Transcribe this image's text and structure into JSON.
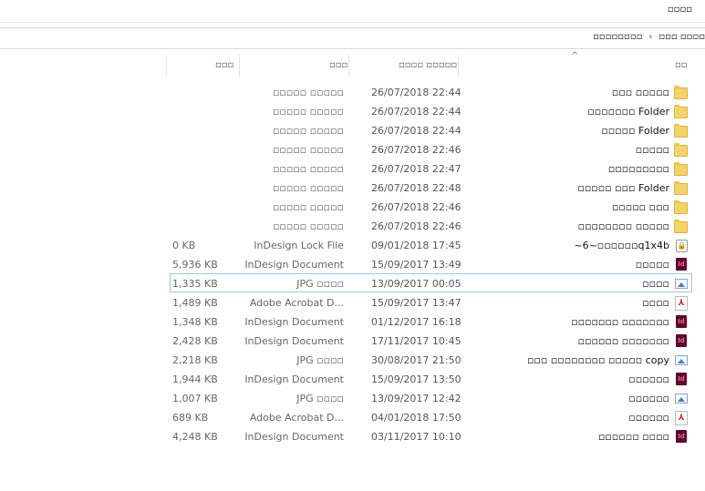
{
  "toolbar": {
    "view_tab": "▫▫▫▫"
  },
  "address": {
    "parent": "▫▫▫ ▫▫▫▫",
    "separator": "‹",
    "current": "▫▫▫▫▫▫▫▫"
  },
  "columns": {
    "name": "▫▫",
    "date": "▫▫▫▫ ▫▫▫▫▫",
    "type": "▫▫▫",
    "size": "▫▫▫"
  },
  "files": [
    {
      "name": "▫▫▫ ▫▫▫▫▫",
      "date": "26/07/2018 22:44",
      "type": "▫▫▫▫▫ ▫▫▫▫▫",
      "size": "",
      "icon": "folder-icon"
    },
    {
      "name": "▫▫▫▫▫▫▫ Folder",
      "date": "26/07/2018 22:44",
      "type": "▫▫▫▫▫ ▫▫▫▫▫",
      "size": "",
      "icon": "folder-icon"
    },
    {
      "name": "▫▫▫▫▫ Folder",
      "date": "26/07/2018 22:44",
      "type": "▫▫▫▫▫ ▫▫▫▫▫",
      "size": "",
      "icon": "folder-icon"
    },
    {
      "name": "▫▫▫▫▫",
      "date": "26/07/2018 22:46",
      "type": "▫▫▫▫▫ ▫▫▫▫▫",
      "size": "",
      "icon": "folder-icon"
    },
    {
      "name": "▫▫▫▫▫▫▫▫▫",
      "date": "26/07/2018 22:47",
      "type": "▫▫▫▫▫ ▫▫▫▫▫",
      "size": "",
      "icon": "folder-icon"
    },
    {
      "name": "▫▫▫▫▫ ▫▫▫ Folder",
      "date": "26/07/2018 22:48",
      "type": "▫▫▫▫▫ ▫▫▫▫▫",
      "size": "",
      "icon": "folder-icon"
    },
    {
      "name": "▫▫▫▫▫ ▫▫▫",
      "date": "26/07/2018 22:46",
      "type": "▫▫▫▫▫ ▫▫▫▫▫",
      "size": "",
      "icon": "folder-icon"
    },
    {
      "name": "▫▫▫▫▫▫▫▫ ▫▫▫▫▫",
      "date": "26/07/2018 22:46",
      "type": "▫▫▫▫▫ ▫▫▫▫▫",
      "size": "",
      "icon": "folder-icon"
    },
    {
      "name": "~6~▫▫▫▫▫▫q1x4b",
      "date": "09/01/2018 17:45",
      "type": "InDesign Lock File",
      "size": "0 KB",
      "icon": "lock-file-icon"
    },
    {
      "name": "▫▫▫▫▫",
      "date": "15/09/2017 13:49",
      "type": "InDesign Document",
      "size": "5,936 KB",
      "icon": "indesign-icon"
    },
    {
      "name": "▫▫▫▫",
      "date": "13/09/2017 00:05",
      "type": "JPG ▫▫▫▫",
      "size": "1,335 KB",
      "icon": "image-icon",
      "selected": true
    },
    {
      "name": "▫▫▫▫",
      "date": "15/09/2017 13:47",
      "type": "Adobe Acrobat D...",
      "size": "1,489 KB",
      "icon": "pdf-icon"
    },
    {
      "name": "▫▫▫▫▫▫▫ ▫▫▫▫▫▫▫",
      "date": "01/12/2017 16:18",
      "type": "InDesign Document",
      "size": "1,348 KB",
      "icon": "indesign-icon"
    },
    {
      "name": "▫▫▫▫▫▫ ▫▫▫▫▫▫▫",
      "date": "17/11/2017 10:45",
      "type": "InDesign Document",
      "size": "2,428 KB",
      "icon": "indesign-icon"
    },
    {
      "name": "▫▫▫ ▫▫▫▫▫▫▫▫ ▫▫▫▫▫ copy",
      "date": "30/08/2017 21:50",
      "type": "JPG ▫▫▫▫",
      "size": "2,218 KB",
      "icon": "image-icon"
    },
    {
      "name": "▫▫▫▫▫▫",
      "date": "15/09/2017 13:50",
      "type": "InDesign Document",
      "size": "1,944 KB",
      "icon": "indesign-icon"
    },
    {
      "name": "▫▫▫▫▫▫",
      "date": "13/09/2017 12:42",
      "type": "JPG ▫▫▫▫",
      "size": "1,007 KB",
      "icon": "image-icon"
    },
    {
      "name": "▫▫▫▫▫▫",
      "date": "04/01/2018 17:50",
      "type": "Adobe Acrobat D...",
      "size": "689 KB",
      "icon": "pdf-icon"
    },
    {
      "name": "▫▫▫▫▫▫ ▫▫▫▫",
      "date": "03/11/2017 10:10",
      "type": "InDesign Document",
      "size": "4,248 KB",
      "icon": "indesign-icon"
    }
  ]
}
